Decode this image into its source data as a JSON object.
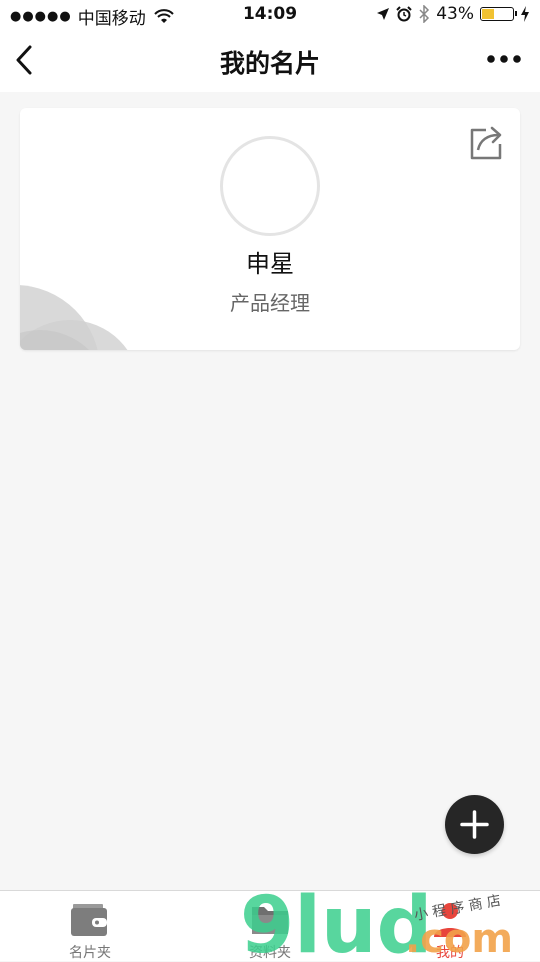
{
  "statusbar": {
    "signal_dots": "●●●●●",
    "carrier": "中国移动",
    "time": "14:09",
    "battery_text": "43%",
    "battery_level": 0.43
  },
  "navbar": {
    "title": "我的名片",
    "back_icon": "chevron-left-icon",
    "more_icon": "ellipsis-icon"
  },
  "card": {
    "name": "申星",
    "job_title": "产品经理",
    "share_icon": "share-icon"
  },
  "fab": {
    "icon": "plus-icon"
  },
  "tabbar": {
    "tabs": [
      {
        "label": "名片夹",
        "icon": "wallet-icon",
        "active": false
      },
      {
        "label": "资料夹",
        "icon": "folder-icon",
        "active": false
      },
      {
        "label": "我的",
        "icon": "user-icon",
        "active": true
      }
    ]
  },
  "watermark": {
    "brand": "9lud",
    "domain": ".com",
    "tagline": "小 程 序 商 店"
  },
  "colors": {
    "accent": "#e8453c",
    "fab": "#262626",
    "battery": "#f1c232",
    "background": "#f6f6f6"
  }
}
